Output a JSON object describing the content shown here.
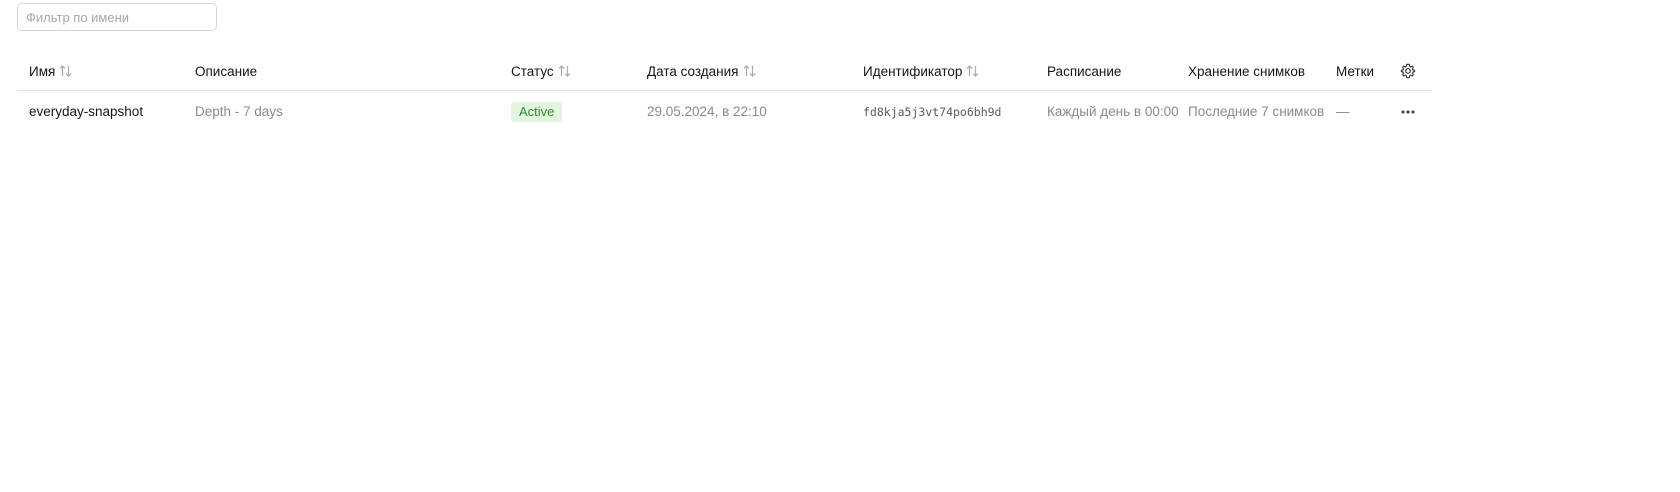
{
  "filter": {
    "placeholder": "Фильтр по имени",
    "value": ""
  },
  "table": {
    "columns": [
      {
        "key": "name",
        "label": "Имя",
        "sortable": true
      },
      {
        "key": "description",
        "label": "Описание",
        "sortable": false
      },
      {
        "key": "status",
        "label": "Статус",
        "sortable": true
      },
      {
        "key": "created",
        "label": "Дата создания",
        "sortable": true
      },
      {
        "key": "id",
        "label": "Идентификатор",
        "sortable": true
      },
      {
        "key": "schedule",
        "label": "Расписание",
        "sortable": false
      },
      {
        "key": "retention",
        "label": "Хранение снимков",
        "sortable": false
      },
      {
        "key": "labels",
        "label": "Метки",
        "sortable": false
      }
    ],
    "rows": [
      {
        "name": "everyday-snapshot",
        "description": "Depth - 7 days",
        "status": "Active",
        "created": "29.05.2024, в 22:10",
        "id": "fd8kja5j3vt74po6bh9d",
        "schedule": "Каждый день в 00:00",
        "retention": "Последние 7 снимков",
        "labels": "—"
      }
    ]
  },
  "icons": {
    "sort": "sort-arrows-icon",
    "settings": "gear-icon",
    "more": "more-horizontal-icon"
  },
  "colors": {
    "status_active_bg": "#e3f5e1",
    "status_active_text": "#2f8a2b"
  }
}
